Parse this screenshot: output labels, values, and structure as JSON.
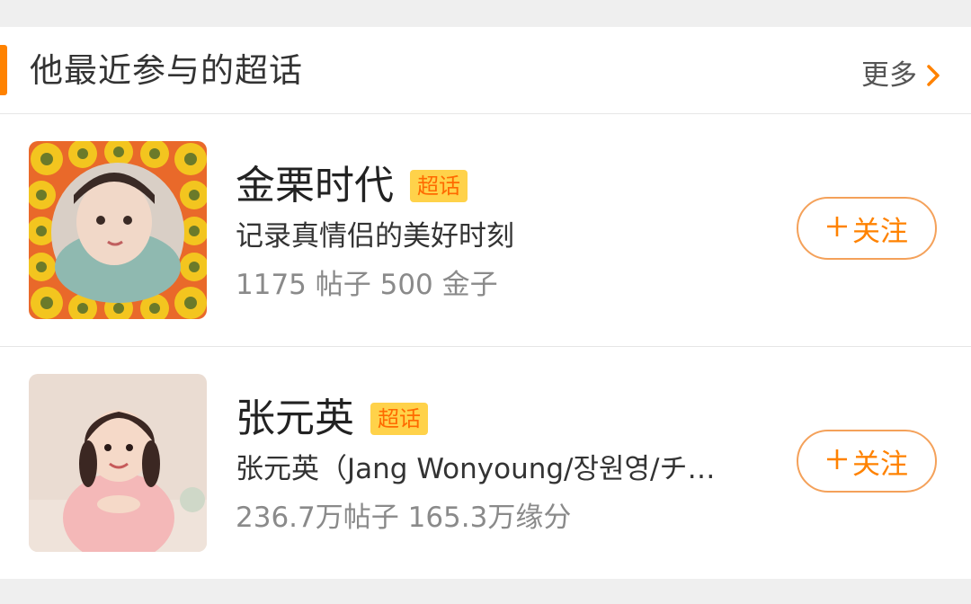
{
  "section": {
    "title": "他最近参与的超话",
    "more_label": "更多"
  },
  "topics": [
    {
      "name": "金栗时代",
      "badge": "超话",
      "description": "记录真情侣的美好时刻",
      "stats": "1175 帖子 500 金子",
      "follow_label": "关注",
      "follow_icon": "plus-icon"
    },
    {
      "name": "张元英",
      "badge": "超话",
      "description": "张元英（Jang Wonyoung/장원영/チ…",
      "stats": "236.7万帖子 165.3万缘分",
      "follow_label": "关注",
      "follow_icon": "plus-icon"
    }
  ],
  "colors": {
    "accent": "#ff8200",
    "badge_bg": "#ffd24a",
    "badge_text": "#ff6a00",
    "follow_border": "#f4a15a"
  }
}
